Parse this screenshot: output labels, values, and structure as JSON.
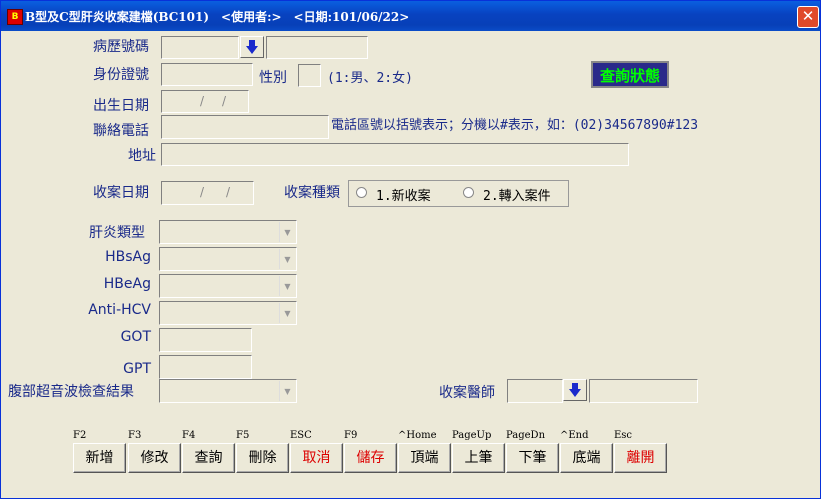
{
  "window": {
    "title": "B型及C型肝炎收案建檔(BC101)　<使用者:>　<日期:101/06/22>",
    "icon": "app-icon",
    "close_label": "✕"
  },
  "form": {
    "chart_no_label": "病歷號碼",
    "id_label": "身份證號",
    "gender_label": "性別",
    "gender_hint": "(1:男、2:女)",
    "birth_label": "出生日期",
    "phone_label": "聯絡電話",
    "phone_hint": "電話區號以括號表示；分機以#表示，如：(02)34567890#123",
    "address_label": "地址",
    "case_date_label": "收案日期",
    "case_type_label": "收案種類",
    "case_type_options": [
      "1.新收案",
      "2.轉入案件"
    ],
    "hepatitis_type_label": "肝炎類型",
    "hbsag_label": "HBsAg",
    "hbeag_label": "HBeAg",
    "antihcv_label": "Anti-HCV",
    "got_label": "GOT",
    "gpt_label": "GPT",
    "ultrasound_label": "腹部超音波檢查結果",
    "doctor_label": "收案醫師",
    "date_sep": "/",
    "status_button": "查詢狀態"
  },
  "toolbar": [
    {
      "key": "F2",
      "label": "新增",
      "color": "#000000"
    },
    {
      "key": "F3",
      "label": "修改",
      "color": "#000000"
    },
    {
      "key": "F4",
      "label": "查詢",
      "color": "#000000"
    },
    {
      "key": "F5",
      "label": "刪除",
      "color": "#000000"
    },
    {
      "key": "ESC",
      "label": "取消",
      "color": "#DD0000"
    },
    {
      "key": "F9",
      "label": "儲存",
      "color": "#DD0000"
    },
    {
      "key": "^Home",
      "label": "頂端",
      "color": "#000000"
    },
    {
      "key": "PageUp",
      "label": "上筆",
      "color": "#000000"
    },
    {
      "key": "PageDn",
      "label": "下筆",
      "color": "#000000"
    },
    {
      "key": "^End",
      "label": "底端",
      "color": "#000000"
    },
    {
      "key": "Esc",
      "label": "離開",
      "color": "#DD0000"
    }
  ]
}
